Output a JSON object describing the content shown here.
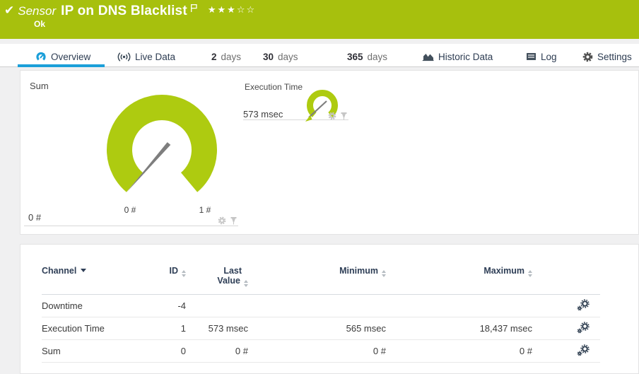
{
  "header": {
    "kind": "Sensor",
    "title": "IP on DNS Blacklist",
    "status": "Ok",
    "stars_filled": "★★★",
    "stars_empty": "☆☆"
  },
  "tabs": {
    "overview": "Overview",
    "live_data": "Live Data",
    "d2_num": "2",
    "d2_unit": "days",
    "d30_num": "30",
    "d30_unit": "days",
    "d365_num": "365",
    "d365_unit": "days",
    "historic": "Historic Data",
    "log": "Log",
    "settings": "Settings"
  },
  "gauges": {
    "sum": {
      "title": "Sum",
      "value": "0 #",
      "scale_min": "0 #",
      "scale_max": "1 #"
    },
    "execution_time": {
      "title": "Execution Time",
      "value": "573 msec"
    }
  },
  "channels": {
    "headers": {
      "channel": "Channel",
      "id": "ID",
      "last1": "Last",
      "last2": "Value",
      "minimum": "Minimum",
      "maximum": "Maximum"
    },
    "rows": [
      {
        "channel": "Downtime",
        "id": "-4",
        "last": "",
        "minimum": "",
        "maximum": ""
      },
      {
        "channel": "Execution Time",
        "id": "1",
        "last": "573 msec",
        "minimum": "565 msec",
        "maximum": "18,437 msec"
      },
      {
        "channel": "Sum",
        "id": "0",
        "last": "0 #",
        "minimum": "0 #",
        "maximum": "0 #"
      }
    ]
  },
  "colors": {
    "status_ok": "#a7c00d",
    "gauge_lime": "#aecb10",
    "accent_blue": "#1b9fd9"
  }
}
